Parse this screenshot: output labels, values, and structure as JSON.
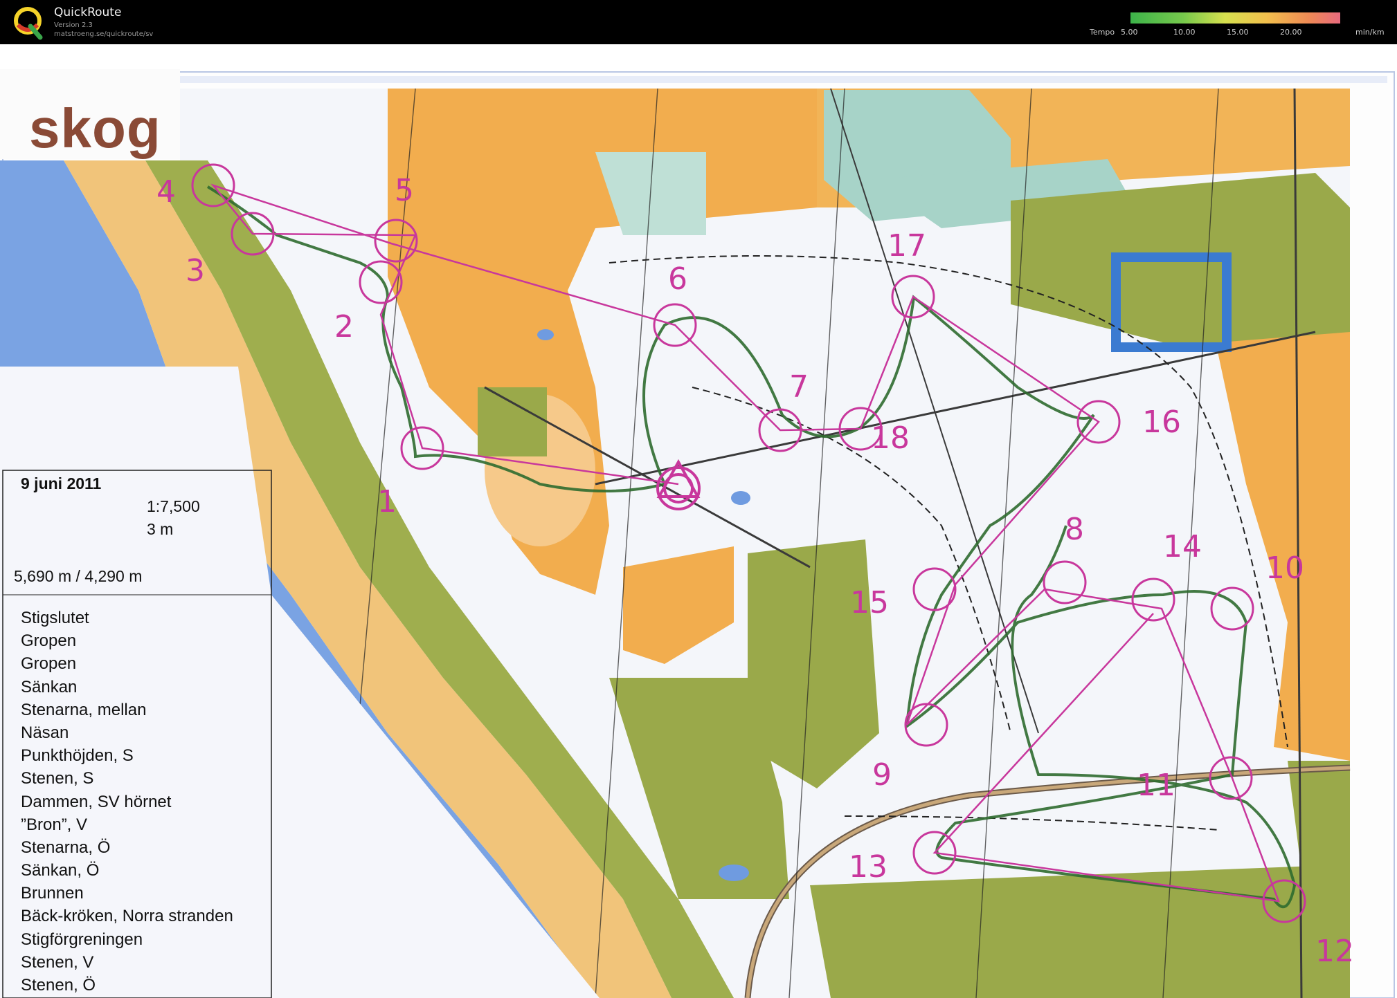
{
  "app": {
    "name": "QuickRoute",
    "version": "Version 2.3",
    "url": "matstroeng.se/quickroute/sv"
  },
  "tempo_scale": {
    "label": "Tempo",
    "ticks": [
      "5.00",
      "10.00",
      "15.00",
      "20.00"
    ],
    "unit": "min/km"
  },
  "map": {
    "title_fragment": "skog",
    "date": "9 juni 2011",
    "scale": "1:7,500",
    "contour_interval": "3 m",
    "course_length": "5,690 m / 4,290 m",
    "control_descriptions": [
      "Stigslutet",
      "Gropen",
      "Gropen",
      "Sänkan",
      "Stenarna, mellan",
      "Näsan",
      "Punkthöjden, S",
      "Stenen, S",
      "Dammen, SV hörnet",
      "”Bron”, V",
      "Stenarna, Ö",
      "Sänkan, Ö",
      "Brunnen",
      "Bäck-kröken, Norra stranden",
      "Stigförgreningen",
      "Stenen, V",
      "Stenen, Ö"
    ],
    "controls": [
      {
        "label": "1"
      },
      {
        "label": "2"
      },
      {
        "label": "3"
      },
      {
        "label": "4"
      },
      {
        "label": "5"
      },
      {
        "label": "6"
      },
      {
        "label": "7"
      },
      {
        "label": "8"
      },
      {
        "label": "9"
      },
      {
        "label": "10"
      },
      {
        "label": "11"
      },
      {
        "label": "12"
      },
      {
        "label": "13"
      },
      {
        "label": "14"
      },
      {
        "label": "15"
      },
      {
        "label": "16"
      },
      {
        "label": "17"
      },
      {
        "label": "18"
      }
    ],
    "colors": {
      "course": "#c8379c",
      "route": "#2f6b2f",
      "open_land": "#f2ae4e",
      "urban": "#9aa94a",
      "water": "#6f9be0",
      "forest": "#f7f8fb",
      "marsh": "#9fcdc2"
    }
  }
}
